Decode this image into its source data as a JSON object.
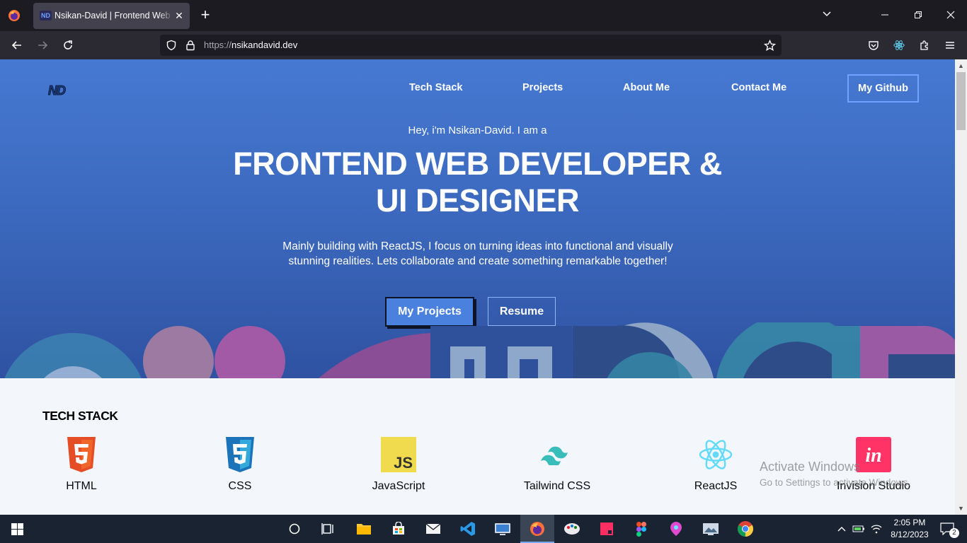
{
  "browser": {
    "tab_title": "Nsikan-David | Frontend Web Developer",
    "tab_favicon_text": "ND",
    "url_protocol": "https://",
    "url_domain": "nsikandavid.dev"
  },
  "nav": {
    "logo_text": "ND",
    "links": [
      "Tech Stack",
      "Projects",
      "About Me",
      "Contact Me"
    ],
    "github_label": "My Github"
  },
  "hero": {
    "greeting": "Hey, i'm Nsikan-David. I am a",
    "headline_line1": "FRONTEND WEB DEVELOPER &",
    "headline_line2": "UI DESIGNER",
    "description_line1": "Mainly building with ReactJS, I focus on turning ideas into functional and visually",
    "description_line2": "stunning realities. Lets collaborate and create something remarkable together!",
    "primary_button": "My Projects",
    "secondary_button": "Resume"
  },
  "tech_stack": {
    "title": "TECH STACK",
    "items": [
      {
        "label": "HTML",
        "icon": "html5-icon",
        "color": "#e44d26"
      },
      {
        "label": "CSS",
        "icon": "css3-icon",
        "color": "#1b73ba"
      },
      {
        "label": "JavaScript",
        "icon": "javascript-icon",
        "color": "#f0db4f"
      },
      {
        "label": "Tailwind CSS",
        "icon": "tailwind-icon",
        "color": "#38bdba"
      },
      {
        "label": "ReactJS",
        "icon": "react-icon",
        "color": "#61dafb"
      },
      {
        "label": "Invision Studio",
        "icon": "invision-icon",
        "color": "#ff3366"
      }
    ]
  },
  "watermark": {
    "line1": "Activate Windows",
    "line2": "Go to Settings to activate Windows."
  },
  "taskbar": {
    "time": "2:05 PM",
    "date": "8/12/2023",
    "notification_count": "2"
  },
  "colors": {
    "hero_top": "#4679d2",
    "hero_bottom": "#2f52a2",
    "accent_button": "#4a80de",
    "section_bg": "#f3f7fc"
  }
}
